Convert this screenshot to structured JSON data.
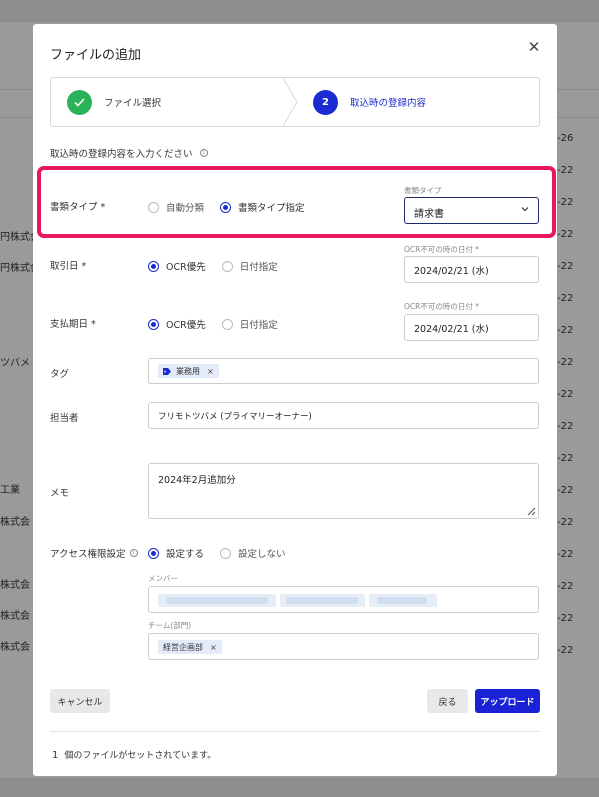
{
  "background": {
    "left_fragments": [
      "円株式会",
      "円株式会",
      "円株式会",
      "ツバメ",
      "工業",
      "株式会",
      "株式会",
      "株式会",
      "株式会"
    ],
    "right_fragments": [
      "-26",
      "-22",
      "-22",
      "-22",
      "-22",
      "-22",
      "-22",
      "-22",
      "-22",
      "-22",
      "-22",
      "-22",
      "-22",
      "-22",
      "-22",
      "-22",
      "-22"
    ]
  },
  "modal": {
    "title": "ファイルの追加",
    "close_icon": "close-icon"
  },
  "stepper": {
    "step1_label": "ファイル選択",
    "step2_number": "2",
    "step2_label": "取込時の登録内容"
  },
  "section_heading": "取込時の登録内容を入力ください",
  "doc_type": {
    "label": "書類タイプ *",
    "option_auto": "自動分類",
    "option_specify": "書類タイプ指定",
    "select_caption": "書類タイプ",
    "select_value": "請求書"
  },
  "transaction_date": {
    "label": "取引日 *",
    "option_ocr": "OCR優先",
    "option_date": "日付指定",
    "caption": "OCR不可の時の日付 *",
    "value": "2024/02/21 (水)"
  },
  "due_date": {
    "label": "支払期日 *",
    "option_ocr": "OCR優先",
    "option_date": "日付指定",
    "caption": "OCR不可の時の日付 *",
    "value": "2024/02/21 (水)"
  },
  "tag": {
    "label": "タグ",
    "chip": "業務用",
    "remove": "×"
  },
  "assignee": {
    "label": "担当者",
    "value": "フリモトツバメ (プライマリーオーナー)"
  },
  "memo": {
    "label": "メモ",
    "value": "2024年2月追加分"
  },
  "access": {
    "label": "アクセス権限設定",
    "option_set": "設定する",
    "option_unset": "設定しない",
    "members_caption": "メンバー",
    "team_caption": "チーム(部門)",
    "team_chip": "経営企画部",
    "remove": "×"
  },
  "buttons": {
    "cancel": "キャンセル",
    "back": "戻る",
    "upload": "アップロード"
  },
  "footer": {
    "count": "1",
    "text": "個のファイルがセットされています。"
  },
  "colors": {
    "primary": "#1a2bd1",
    "success": "#2bb35a",
    "highlight": "#e8185f"
  }
}
